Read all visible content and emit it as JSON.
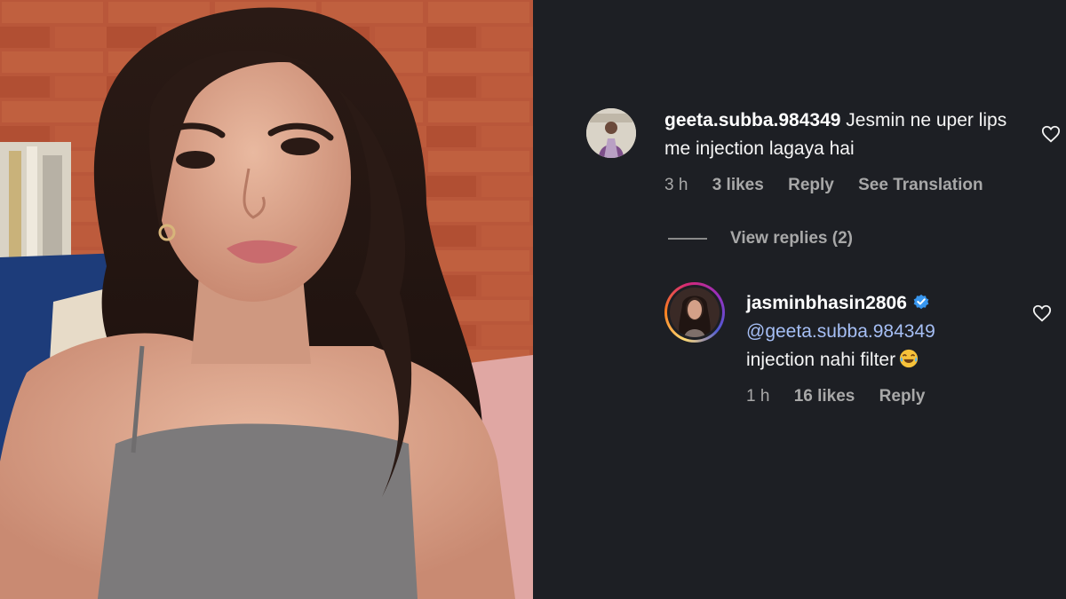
{
  "photo": {
    "subject": "woman-selfie",
    "colors": {
      "brick": "#b8563a",
      "mortar": "#8a3e2a",
      "hair": "#241612",
      "skin": "#d9a48d",
      "top": "#7c7a7b"
    }
  },
  "comments": [
    {
      "username": "geeta.subba.984349",
      "text": "Jesmin ne uper lips me injection lagaya hai",
      "time": "3 h",
      "likes": "3 likes",
      "reply_label": "Reply",
      "translate_label": "See Translation"
    },
    {
      "username": "jasminbhasin2806",
      "verified": true,
      "mention": "@geeta.subba.984349",
      "text": "injection nahi filter",
      "emoji": "face-with-tears-of-joy",
      "time": "1 h",
      "likes": "16 likes",
      "reply_label": "Reply"
    }
  ],
  "view_replies": "View replies (2)",
  "theme": {
    "background": "#1d1f24",
    "text": "#f5f5f5",
    "muted": "#a8a8a8",
    "mention": "#a6bff5",
    "verified": "#3897f0"
  }
}
